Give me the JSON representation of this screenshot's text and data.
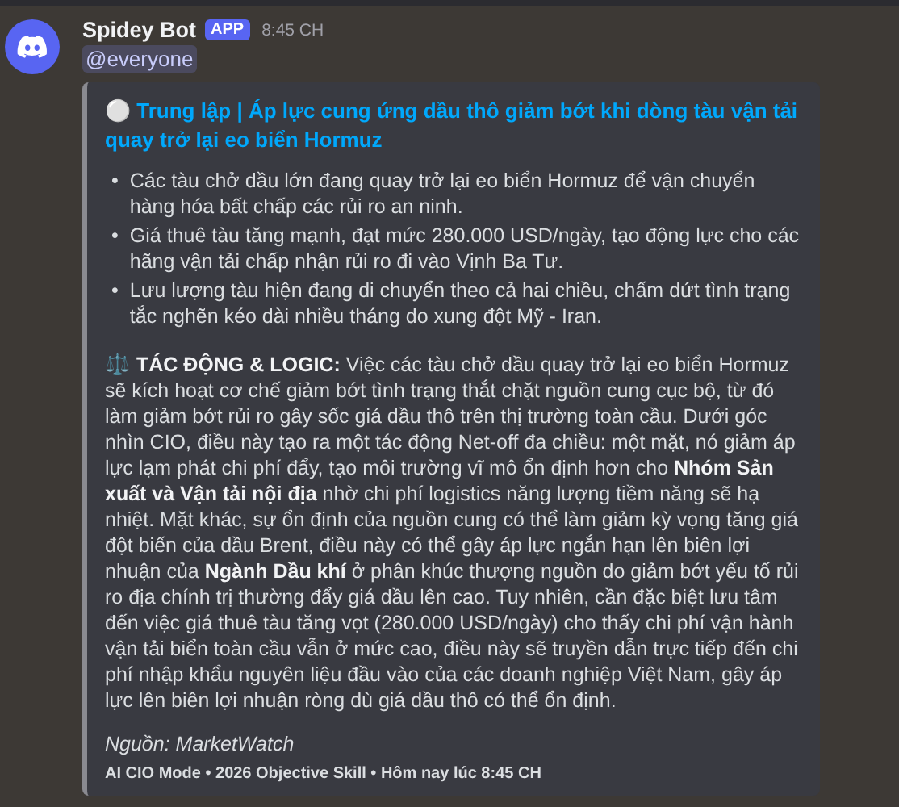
{
  "message": {
    "author": "Spidey Bot",
    "badge": "APP",
    "time": "8:45 CH",
    "mention": "@everyone"
  },
  "embed": {
    "title_icon": "⚪",
    "title": "Trung lập | Áp lực cung ứng dầu thô giảm bớt khi dòng tàu vận tải quay trở lại eo biển Hormuz",
    "bullets": [
      {
        "marker": "•",
        "text": "Các tàu chở dầu lớn đang quay trở lại eo biển Hormuz để vận chuyển hàng hóa bất chấp các rủi ro an ninh."
      },
      {
        "marker": "•",
        "text": "Giá thuê tàu tăng mạnh, đạt mức 280.000 USD/ngày, tạo động lực cho các hãng vận tải chấp nhận rủi ro đi vào Vịnh Ba Tư."
      },
      {
        "marker": "•",
        "text": "Lưu lượng tàu hiện đang di chuyển theo cả hai chiều, chấm dứt tình trạng tắc nghẽn kéo dài nhiều tháng do xung đột Mỹ - Iran."
      }
    ],
    "analysis": "⚖️ **TÁC ĐỘNG & LOGIC:** Việc các tàu chở dầu quay trở lại eo biển Hormuz sẽ kích hoạt cơ chế giảm bớt tình trạng thắt chặt nguồn cung cục bộ, từ đó làm giảm bớt rủi ro gây sốc giá dầu thô trên thị trường toàn cầu. Dưới góc nhìn CIO, điều này tạo ra một tác động Net-off đa chiều: một mặt, nó giảm áp lực lạm phát chi phí đẩy, tạo môi trường vĩ mô ổn định hơn cho **Nhóm Sản xuất và Vận tải nội địa** nhờ chi phí logistics năng lượng tiềm năng sẽ hạ nhiệt. Mặt khác, sự ổn định của nguồn cung có thể làm giảm kỳ vọng tăng giá đột biến của dầu Brent, điều này có thể gây áp lực ngắn hạn lên biên lợi nhuận của **Ngành Dầu khí** ở phân khúc thượng nguồn do giảm bớt yếu tố rủi ro địa chính trị thường đẩy giá dầu lên cao. Tuy nhiên, cần đặc biệt lưu tâm đến việc giá thuê tàu tăng vọt (280.000 USD/ngày) cho thấy chi phí vận hành vận tải biển toàn cầu vẫn ở mức cao, điều này sẽ truyền dẫn trực tiếp đến chi phí nhập khẩu nguyên liệu đầu vào của các doanh nghiệp Việt Nam, gây áp lực lên biên lợi nhuận ròng dù giá dầu thô có thể ổn định.",
    "source": "Nguồn: MarketWatch",
    "footer": "AI CIO Mode • 2026 Objective Skill • Hôm nay lúc 8:45 CH"
  }
}
